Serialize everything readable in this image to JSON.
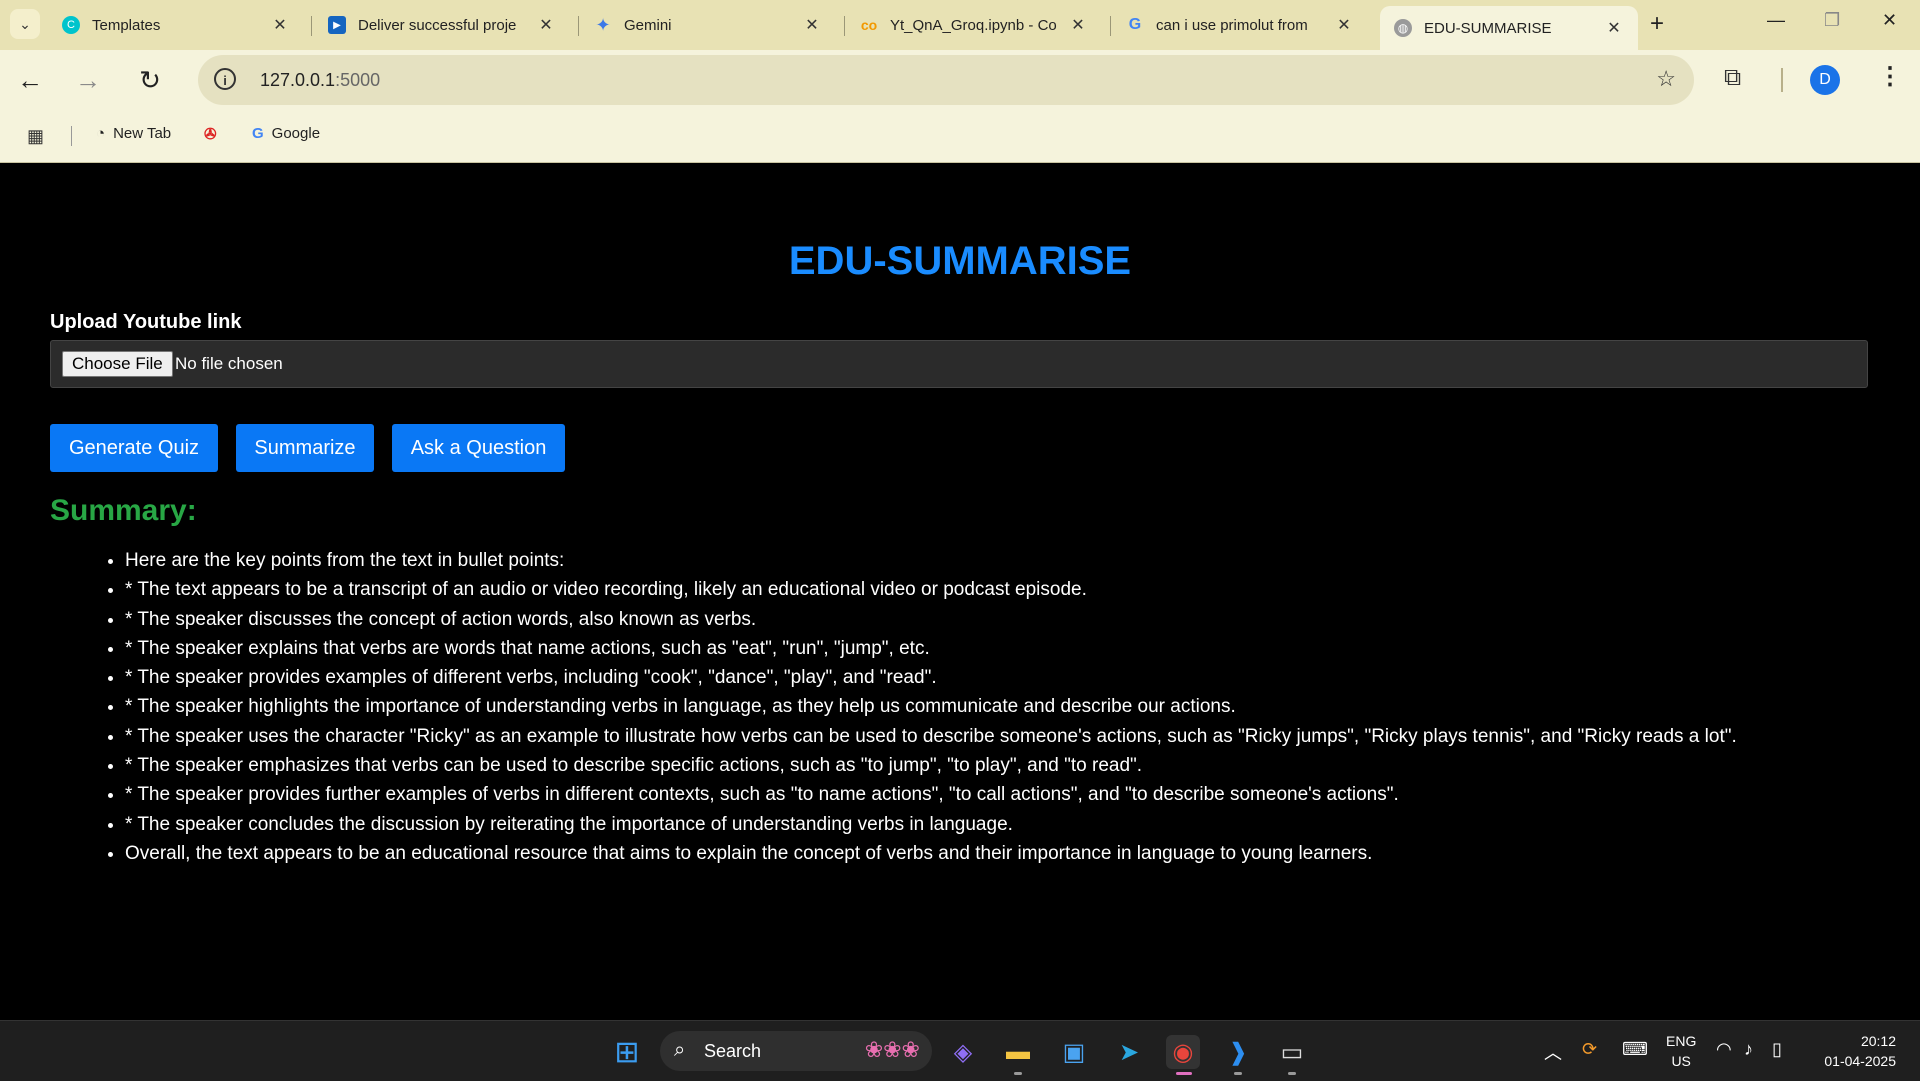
{
  "browser": {
    "tabs": [
      {
        "title": "Templates",
        "icon": "canva-icon",
        "active": false
      },
      {
        "title": "Deliver successful proje",
        "icon": "youtube-icon",
        "active": false
      },
      {
        "title": "Gemini",
        "icon": "gemini-icon",
        "active": false
      },
      {
        "title": "Yt_QnA_Groq.ipynb - Co",
        "icon": "colab-icon",
        "active": false
      },
      {
        "title": "can i use primolut from",
        "icon": "google-icon",
        "active": false
      },
      {
        "title": "EDU-SUMMARISE",
        "icon": "globe-icon",
        "active": true
      }
    ],
    "url_host": "127.0.0.1",
    "url_port": ":5000",
    "profile_initial": "D",
    "bookmarks": [
      {
        "label": "New Tab",
        "icon": "newtab-icon"
      },
      {
        "label": "",
        "icon": "bookmark-logo-icon"
      },
      {
        "label": "Google",
        "icon": "google-icon"
      }
    ]
  },
  "page": {
    "title": "EDU-SUMMARISE",
    "upload_label": "Upload Youtube link",
    "choose_file": "Choose File",
    "no_file": "No file chosen",
    "buttons": {
      "quiz": "Generate Quiz",
      "summarize": "Summarize",
      "ask": "Ask a Question"
    },
    "summary_heading": "Summary:",
    "summary_items": [
      "Here are the key points from the text in bullet points:",
      "* The text appears to be a transcript of an audio or video recording, likely an educational video or podcast episode.",
      "* The speaker discusses the concept of action words, also known as verbs.",
      "* The speaker explains that verbs are words that name actions, such as \"eat\", \"run\", \"jump\", etc.",
      "* The speaker provides examples of different verbs, including \"cook\", \"dance\", \"play\", and \"read\".",
      "* The speaker highlights the importance of understanding verbs in language, as they help us communicate and describe our actions.",
      "* The speaker uses the character \"Ricky\" as an example to illustrate how verbs can be used to describe someone's actions, such as \"Ricky jumps\", \"Ricky plays tennis\", and \"Ricky reads a lot\".",
      "* The speaker emphasizes that verbs can be used to describe specific actions, such as \"to jump\", \"to play\", and \"to read\".",
      "* The speaker provides further examples of verbs in different contexts, such as \"to name actions\", \"to call actions\", and \"to describe someone's actions\".",
      "* The speaker concludes the discussion by reiterating the importance of understanding verbs in language.",
      "Overall, the text appears to be an educational resource that aims to explain the concept of verbs and their importance in language to young learners."
    ]
  },
  "taskbar": {
    "search_label": "Search",
    "lang_line1": "ENG",
    "lang_line2": "US",
    "time": "20:12",
    "date": "01-04-2025"
  },
  "colors": {
    "title_blue": "#1a8cff",
    "button_blue": "#0a78f5",
    "summary_green": "#28a745",
    "chrome_frame": "#e8e2b4"
  }
}
